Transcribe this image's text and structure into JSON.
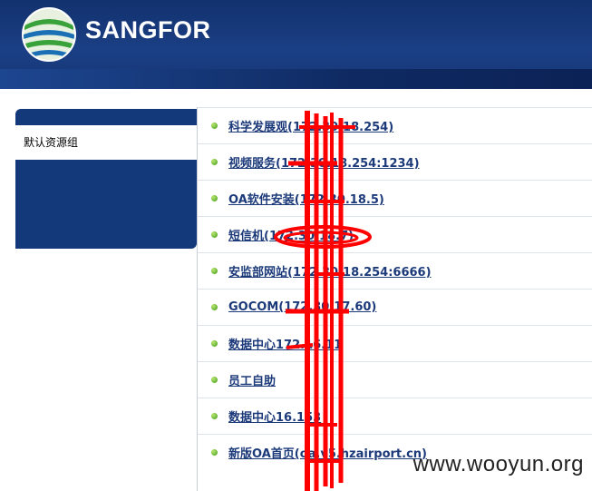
{
  "header": {
    "logo_text": "SANGFOR",
    "logo_icon": "globe-icon"
  },
  "sidebar": {
    "items": [
      {
        "label": "默认资源组"
      }
    ]
  },
  "resources": [
    {
      "label": "科学发展观(172.30.18.254)"
    },
    {
      "label": "视频服务(172.30.18.254:1234)"
    },
    {
      "label": "OA软件安装(172.30.18.5)"
    },
    {
      "label": "短信机(172.30.18.7)"
    },
    {
      "label": "安监部网站(172.30.18.254:6666)"
    },
    {
      "label": "GOCOM(172.30.17.60)"
    },
    {
      "label": "数据中心172.16.11"
    },
    {
      "label": "员工自助"
    },
    {
      "label": "数据中心16.153"
    },
    {
      "label": "新版OA首页(oa.v5.hzairport.cn)"
    }
  ],
  "watermark": "www.wooyun.org",
  "colors": {
    "header": "#163677",
    "sidebar": "#13397a",
    "link": "#1c3a7a",
    "bullet": "#6fb83a",
    "redaction": "#ff0000"
  }
}
